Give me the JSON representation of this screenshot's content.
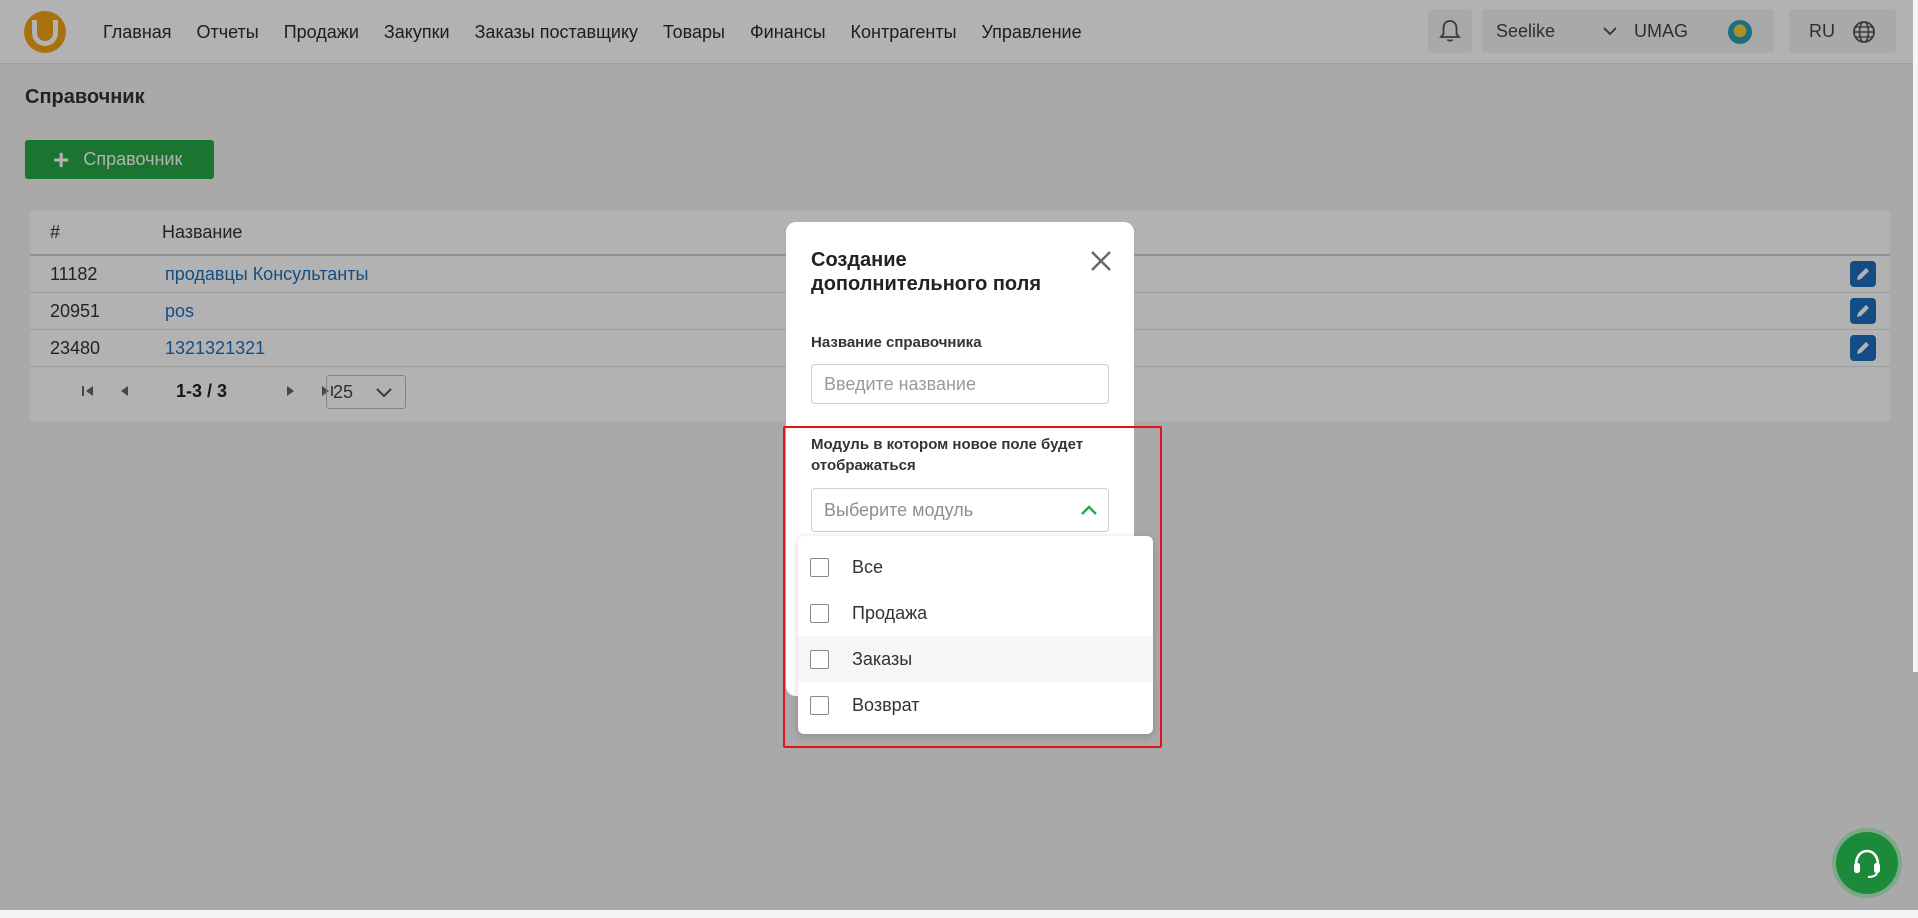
{
  "nav": {
    "items": [
      "Главная",
      "Отчеты",
      "Продажи",
      "Закупки",
      "Заказы поставщику",
      "Товары",
      "Финансы",
      "Контрагенты",
      "Управление"
    ]
  },
  "header": {
    "company": "Seelike",
    "store": "UMAG",
    "language": "RU"
  },
  "page": {
    "title": "Справочник",
    "add_button": "Справочник"
  },
  "table": {
    "columns": [
      "#",
      "Название"
    ],
    "rows": [
      {
        "id": "11182",
        "name": "продавцы Консультанты"
      },
      {
        "id": "20951",
        "name": "pos"
      },
      {
        "id": "23480",
        "name": "1321321321"
      }
    ],
    "pagination": {
      "range": "1-3 / 3",
      "page_size": "25"
    }
  },
  "modal": {
    "title": "Создание дополнительного поля",
    "name_label": "Название справочника",
    "name_placeholder": "Введите название",
    "module_label": "Модуль в котором новое поле будет отображаться",
    "module_placeholder": "Выберите модуль",
    "options": [
      "Все",
      "Продажа",
      "Заказы",
      "Возврат"
    ]
  },
  "icons": {
    "logo": "umag-logo-icon",
    "bell": "bell-icon",
    "chevron": "chevron-down-icon",
    "globe": "globe-icon",
    "edit": "pencil-icon",
    "close": "close-icon",
    "support": "headset-icon"
  },
  "colors": {
    "accent_green": "#28a745",
    "link_blue": "#1e6fc1",
    "logo_orange": "#f0a415",
    "highlight_red": "#e0121a"
  }
}
